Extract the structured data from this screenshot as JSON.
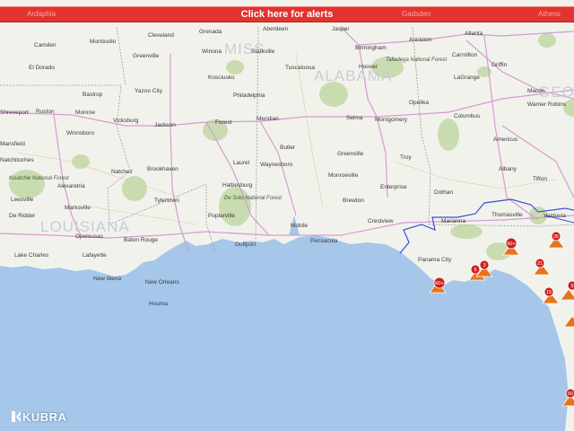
{
  "alert_banner": {
    "label": "Click here for alerts",
    "underlying_labels": [
      "Ardaphia",
      "Gadsden",
      "Athens"
    ]
  },
  "logo": {
    "text": "KUBRA"
  },
  "map": {
    "states": [
      "MISS",
      "ALABAMA",
      "LOUISIANA",
      "GEORGIA"
    ],
    "cities": [
      "Cleveland",
      "Grenada",
      "Aberdeen",
      "Jasper",
      "Anniston",
      "Atlanta",
      "Camden",
      "Monticello",
      "Winona",
      "Starkville",
      "Birmingham",
      "Carrollton",
      "Greenville",
      "Kosciusko",
      "Tuscaloosa",
      "Hoover",
      "Griffin",
      "Talladega National Forest",
      "El Dorado",
      "LaGrange",
      "Macon",
      "Bastrop",
      "Yazoo City",
      "Philadelphia",
      "Opelika",
      "Warner Robins",
      "Ruston",
      "Monroe",
      "Vicksburg",
      "Jackson",
      "Forest",
      "Meridian",
      "Selma",
      "Montgomery",
      "Columbus",
      "Shreveport",
      "Winnsboro",
      "Butler",
      "Americus",
      "Natchitoches",
      "Natchez",
      "Brookhaven",
      "Laurel",
      "Waynesboro",
      "Greenville",
      "Troy",
      "Albany",
      "Tifton",
      "Kisatchie National Forest",
      "Alexandria",
      "Hattiesburg",
      "Monroeville",
      "Enterprise",
      "Dothan",
      "Leesville",
      "Tylertown",
      "De Soto National Forest",
      "Brewton",
      "Thomasville",
      "Valdosta",
      "De Ridder",
      "Poplarville",
      "Mobile",
      "Crestview",
      "Marianna",
      "Opelousas",
      "Baton Rouge",
      "Gulfport",
      "Pensacola",
      "Panama City",
      "Lake Charles",
      "Lafayette",
      "New Iberia",
      "New Orleans",
      "Houma",
      "Marksville",
      "Mansfield"
    ],
    "colors": {
      "water": "#a6c6ea",
      "land": "#f2f2ec",
      "forest": "#c8dcb0",
      "outage_marker": "#e8741a",
      "service_boundary": "#3b4fd6",
      "alert_bar": "#e2342f"
    }
  },
  "outage_markers": [
    {
      "label": "60+"
    },
    {
      "label": "60+"
    },
    {
      "label": "6"
    },
    {
      "label": "3"
    },
    {
      "label": "21"
    },
    {
      "label": "35"
    },
    {
      "label": "15"
    },
    {
      "label": "5"
    },
    {
      "label": "60"
    },
    {
      "label": ""
    }
  ]
}
